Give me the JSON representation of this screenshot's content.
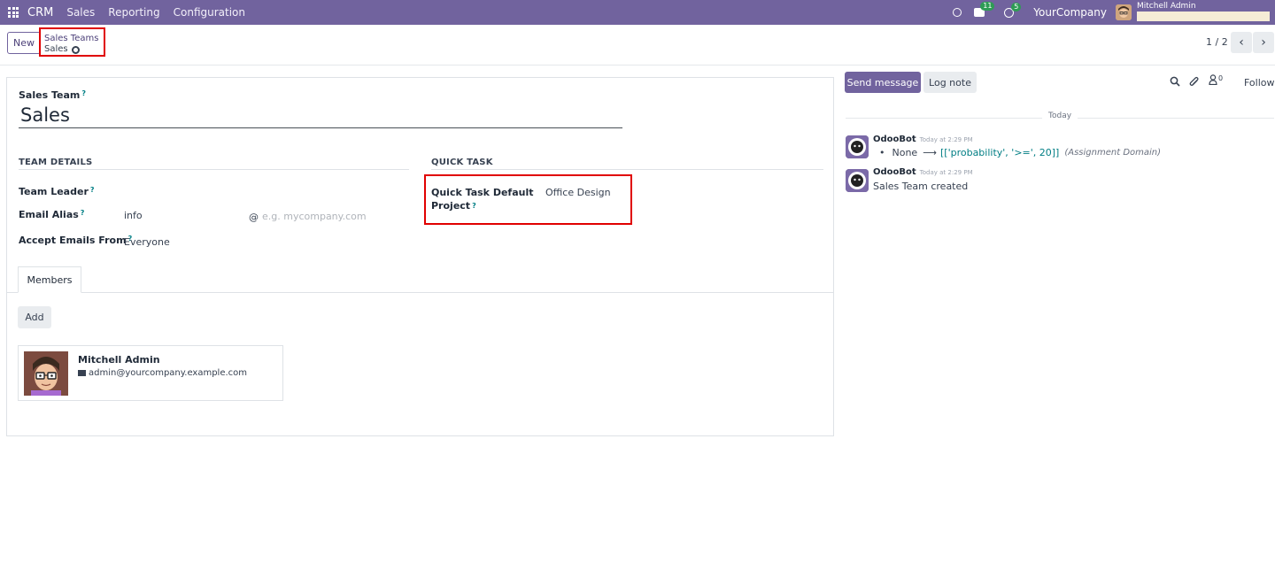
{
  "navbar": {
    "app_name": "CRM",
    "menu": [
      "Sales",
      "Reporting",
      "Configuration"
    ],
    "messages_count": "11",
    "activities_count": "5",
    "company": "YourCompany",
    "user_name": "Mitchell Admin"
  },
  "control_panel": {
    "new_label": "New",
    "breadcrumb_parent": "Sales Teams",
    "breadcrumb_current": "Sales",
    "pager": "1 / 2"
  },
  "form": {
    "name_label": "Sales Team",
    "name_help": "?",
    "name_value": "Sales",
    "team_details_title": "TEAM DETAILS",
    "quick_task_title": "QUICK TASK",
    "team_leader_label": "Team Leader",
    "email_alias_label": "Email Alias",
    "email_alias_value": "info",
    "alias_at": "@",
    "alias_domain_placeholder": "e.g. mycompany.com",
    "accept_emails_label": "Accept Emails From",
    "accept_emails_value": "Everyone",
    "quick_task_label_line1": "Quick Task Default",
    "quick_task_label_line2": "Project",
    "quick_task_value": "Office Design",
    "tab_members": "Members",
    "add_label": "Add",
    "member": {
      "name": "Mitchell Admin",
      "email": "admin@yourcompany.example.com"
    }
  },
  "chatter": {
    "send_message": "Send message",
    "log_note": "Log note",
    "followers_count": "0",
    "follow": "Follow",
    "date_separator": "Today",
    "messages": [
      {
        "author": "OdooBot",
        "time": "Today at 2:29 PM",
        "tracking_old": "None",
        "tracking_arrow": "⟶",
        "tracking_new": "[['probability', '>=', 20]]",
        "tracking_field": "(Assignment Domain)"
      },
      {
        "author": "OdooBot",
        "time": "Today at 2:29 PM",
        "body": "Sales Team created"
      }
    ]
  },
  "colors": {
    "navbar": "#71639e",
    "highlight": "#e00000",
    "help": "#017e84",
    "badge": "#2f9c55"
  }
}
